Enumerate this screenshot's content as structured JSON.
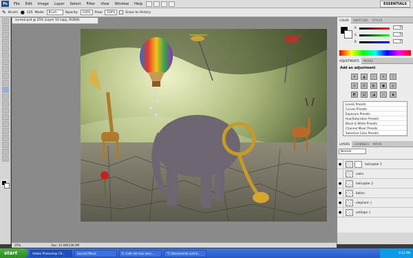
{
  "menubar": {
    "logo": "Ps",
    "items": [
      "File",
      "Edit",
      "Image",
      "Layer",
      "Select",
      "Filter",
      "View",
      "Window",
      "Help"
    ],
    "workspace": "ESSENTIALS"
  },
  "options": {
    "brush_label": "Brush:",
    "brush_size": "125",
    "mode_label": "Mode:",
    "mode_value": "Brush",
    "opacity_label": "Opacity:",
    "opacity_value": "100%",
    "flow_label": "Flow:",
    "flow_value": "100%",
    "erase_label": "Erase to History"
  },
  "document": {
    "tab_title": "surreal.psd @ 25% (Layer 10 copy, RGB/8)",
    "zoom": "25%",
    "doc_size": "Doc: 22.8M/338.9M"
  },
  "color_panel": {
    "tabs": [
      "COLOR",
      "SWATCHES",
      "STYLES"
    ],
    "channels": [
      {
        "label": "R",
        "value": "0"
      },
      {
        "label": "G",
        "value": "0"
      },
      {
        "label": "B",
        "value": "0"
      }
    ]
  },
  "adjustments": {
    "tabs": [
      "ADJUSTMENTS",
      "MASKS"
    ],
    "title": "Add an adjustment",
    "presets": [
      "Levels Presets",
      "Curves Presets",
      "Exposure Presets",
      "Hue/Saturation Presets",
      "Black & White Presets",
      "Channel Mixer Presets",
      "Selective Color Presets"
    ]
  },
  "layers_panel": {
    "tabs": [
      "LAYERS",
      "CHANNELS",
      "PATHS"
    ],
    "blend_mode": "Normal",
    "layers": [
      {
        "name": "helicopter 1",
        "visible": true
      },
      {
        "name": "violin",
        "visible": false
      },
      {
        "name": "helicopter 2",
        "visible": true
      },
      {
        "name": "ballon",
        "visible": true
      },
      {
        "name": "elephant :)",
        "visible": true
      },
      {
        "name": "antilope :)",
        "visible": true
      }
    ]
  },
  "taskbar": {
    "start": "start",
    "tasks": [
      "Adobe Photoshop CS...",
      "Surreal Music",
      "6. Cafe del mar sess...",
      "\"C:\\Documents and S..."
    ],
    "time": "9:31 PM"
  }
}
